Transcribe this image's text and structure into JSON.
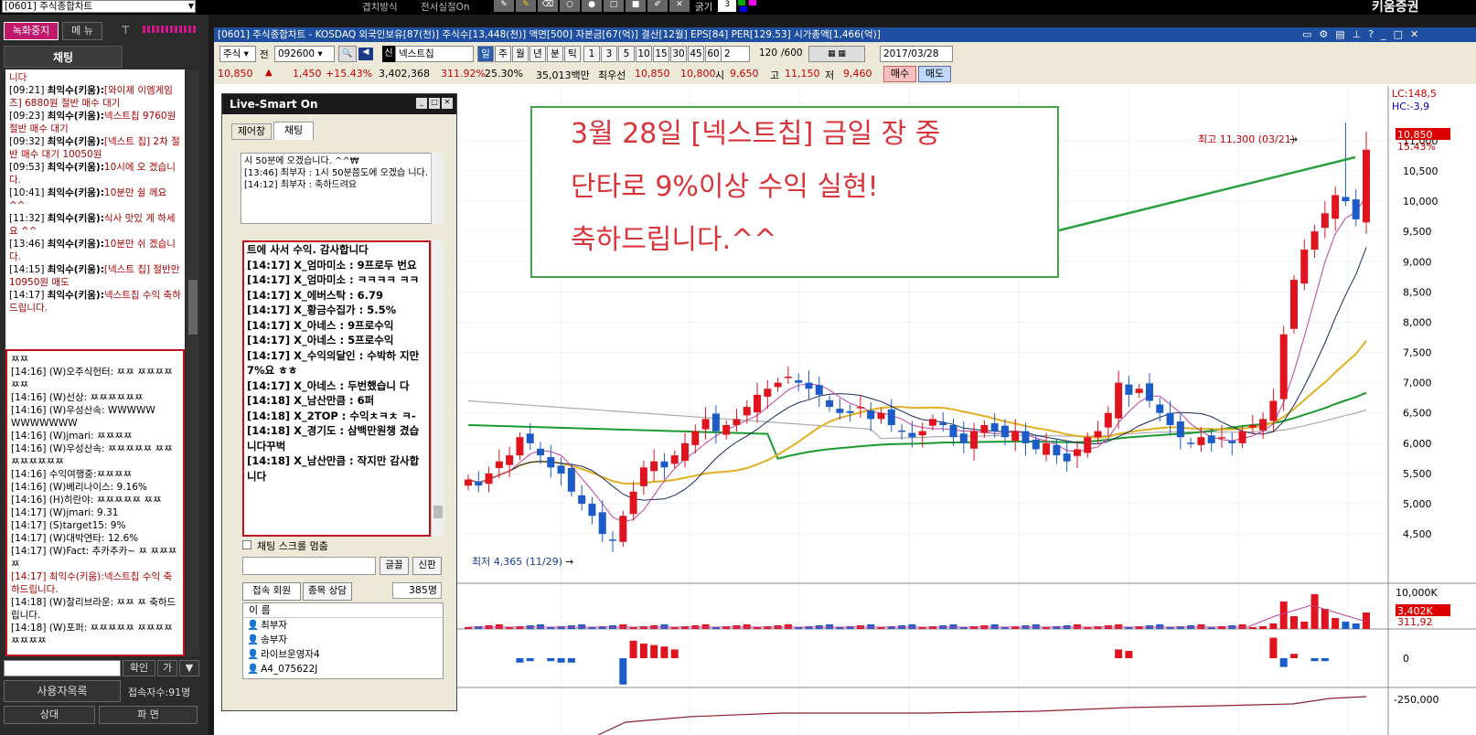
{
  "topbar": {
    "screen_select": "[0601] 주식종합차트",
    "tools": [
      "겹치방식",
      "전서실절On"
    ],
    "line_width_label": "굵기",
    "line_width_value": "3",
    "brand": "키움증권"
  },
  "left_panel": {
    "record_stop": "녹화중지",
    "menu": "메 뉴",
    "chat_tab": "채팅",
    "chat_top": [
      {
        "text": "니다"
      },
      {
        "ts": "[09:21]",
        "name": "최익수(키움):",
        "msg": "[와이제 이엠게임즈] 6880원 절반 매수 대기"
      },
      {
        "ts": "[09:23]",
        "name": "최익수(키움):",
        "msg": "넥스트칩 9760원 절반 매수 대기"
      },
      {
        "ts": "[09:32]",
        "name": "최익수(키움):",
        "msg": "[넥스트 칩] 2차 절반 매수 대기 10050원"
      },
      {
        "ts": "[09:53]",
        "name": "최익수(키움):",
        "msg": "10시에 오 겠습니다."
      },
      {
        "ts": "[10:41]",
        "name": "최익수(키움):",
        "msg": "10분만 쉴 께요^^"
      },
      {
        "ts": "[11:32]",
        "name": "최익수(키움):",
        "msg": "식사 맛있 게 하세요 ^^"
      },
      {
        "ts": "[13:46]",
        "name": "최익수(키움):",
        "msg": "10분만 쉬 겠습니다."
      },
      {
        "ts": "[14:15]",
        "name": "최익수(키움):",
        "msg": "[넥스트 칩] 절반만 10950원 매도"
      },
      {
        "ts": "[14:17]",
        "name": "최익수(키움):",
        "msg": "넥스트칩 수익 축하드립니다."
      }
    ],
    "chat_bottom": [
      "ㅉㅉ",
      "[14:16] (W)오주식헌터: ㅉㅉ ㅉㅉㅉㅉㅉㅉ",
      "[14:16] (W)선상: ㅉㅉㅉㅉㅉㅉ",
      "[14:16] (W)우성산속: WWWWW WWWWWWW",
      "[14:16] (W)jmari: ㅉㅉㅉㅉ",
      "[14:16] (W)우성산속: ㅉㅉㅉㅉㅉ ㅉㅉㅉㅉㅉㅉㅉㅉ",
      "[14:16] 수익여행중:ㅉㅉㅉㅉ",
      "[14:16] (W)베리나이스: 9.16%",
      "[14:16] (H)히란야: ㅉㅉㅉㅉㅉ ㅉㅉ",
      "[14:17] (W)jmari: 9.31",
      "[14:17] (S)target15: 9%",
      "[14:17] (W)대박연타: 12.6%",
      "[14:17] (W)Fact: 추카추카~ ㅉ ㅉㅉㅉㅉ",
      "[14:17] 최익수(키움):넥스트칩 수익 축하드립니다.",
      "[14:18] (W)찰리브라운: ㅉㅉ ㅉ 축하드립니다.",
      "[14:18] (W)포퍼: ㅉㅉㅉㅉㅉ ㅉㅉㅉㅉㅉㅉㅉㅉ"
    ],
    "confirm_btn": "확인",
    "small_btn": "가",
    "users_btn": "사용자목록",
    "users_count": "접속자수:91명",
    "bottom_tabs": [
      "상대",
      "파 면"
    ]
  },
  "chart_window": {
    "title": "[0601] 주식종합차트 - KOSDAQ 외국인보유[87(천)] 주식수[13,448(천)] 액면[500] 자본금[67(억)] 결산[12월] EPS[84] PER[129.53] 시가총액[1,466(억)]",
    "toolbar": {
      "market": "주식",
      "prefix": "전",
      "code": "092600",
      "credit_badge": "신",
      "name": "넥스트칩",
      "periods": [
        "일",
        "주",
        "월",
        "년",
        "분",
        "틱"
      ],
      "minutes": [
        "1",
        "3",
        "5",
        "10",
        "15",
        "30",
        "45",
        "60"
      ],
      "multiplier": "2",
      "view_count": "120",
      "total_count": "/600",
      "date": "2017/03/28",
      "price": "10,850",
      "change": "1,450",
      "change_pct": "+15.43%",
      "volume": "3,402,368",
      "vol_ratio": "311.92%",
      "turnover": "25.30%",
      "amount": "35,013백만",
      "best_ask_label": "최우선",
      "best_ask": "10,850",
      "best_bid": "10,800",
      "open_label": "시",
      "open": "9,650",
      "high_label": "고",
      "high": "11,150",
      "low_label": "저",
      "low": "9,460",
      "buy": "매수",
      "sell": "매도"
    },
    "right_labels": {
      "lc": "LC:148,5",
      "hc": "HC:-3,9",
      "price_tag": "10,850",
      "pct_tag": "15.43%",
      "vol_tag": "3,402K",
      "vol_pct_tag": "311,92"
    }
  },
  "live_smart": {
    "title": "Live-Smart On",
    "tabs": [
      "제어창",
      "채팅"
    ],
    "upper_chat": [
      "시 50분에 오겠습니다. ^^₩",
      "[13:46] 최부자 : 1시 50분쯤도에 오겠습 니다.",
      "[14:12] 최부자 : 축하드려요"
    ],
    "lower_chat": [
      "트에 사서 수익. 감사합니다",
      "[14:17] X_엄마미소 : 9프로두 번요",
      "[14:17] X_엄마미소 : ㅋㅋㅋㅋ ㅋㅋ",
      "[14:17] X_에버스탁 : 6.79",
      "[14:17] X_황금수집가 : 5.5%",
      "[14:17] X_아네스 : 9프로수익",
      "[14:17] X_아네스 : 5프로수익",
      "[14:17] X_수익의달인 : 수박하 지만 7%요 ㅎㅎ",
      "[14:17] X_아네스 : 두번했습니 다",
      "[14:18] X_남산만큼 : 6퍼",
      "[14:18] X_2TOP : 수익ㅊㅋㅊ ㅋ-",
      "[14:18] X_경기도 : 삼백만원챙 겼습니다꾸벅",
      "[14:18] X_남산만큼 : 작지만 감사합니다"
    ],
    "scroll_stop": "채팅 스크롤 멈춤",
    "font_btn": "글꼴",
    "report_btn": "신판",
    "tab_members": "접속 회원",
    "tab_stocks": "종목 상담",
    "member_count": "385명",
    "list_header": "이 름",
    "members": [
      "최부자",
      "송부자",
      "라이브운영자4",
      "A4_075622J"
    ]
  },
  "memo": {
    "line1": "3월 28일 [넥스트칩] 금일 장 중",
    "line2": "단타로 9%이상 수익 실현!",
    "line3": "축하드립니다.^^"
  },
  "chart_data": {
    "type": "candlestick",
    "price_axis": [
      "11,000",
      "10,500",
      "10,000",
      "9,500",
      "9,000",
      "8,500",
      "8,000",
      "7,500",
      "7,000",
      "6,500",
      "6,000",
      "5,500",
      "5,000",
      "4,500"
    ],
    "high_annotation": "최고 11,300 (03/21)",
    "low_annotation": "최저 4,365 (11/29)",
    "volume_axis": [
      "10,000K"
    ],
    "osc_axis": [
      "0"
    ],
    "bottom_axis": [
      "-250,000"
    ]
  }
}
